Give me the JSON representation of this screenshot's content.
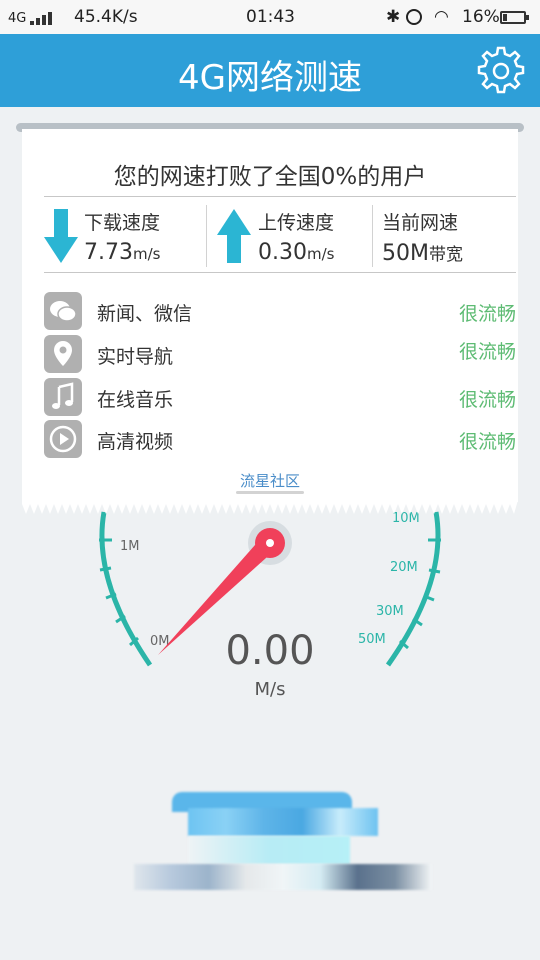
{
  "status_bar": {
    "network": "4G",
    "speed": "45.4K/s",
    "time": "01:43",
    "battery": "16%"
  },
  "header": {
    "title": "4G网络测速"
  },
  "result": {
    "headline": "您的网速打败了全国0%的用户",
    "download": {
      "label": "下载速度",
      "value": "7.73",
      "unit": "m/s"
    },
    "upload": {
      "label": "上传速度",
      "value": "0.30",
      "unit": "m/s"
    },
    "current": {
      "label": "当前网速",
      "value": "50M",
      "unit": "带宽"
    }
  },
  "apps": [
    {
      "name": "新闻、微信",
      "status": "很流畅",
      "icon": "wechat-icon"
    },
    {
      "name": "实时导航",
      "status": "很流畅",
      "icon": "location-pin-icon"
    },
    {
      "name": "在线音乐",
      "status": "很流畅",
      "icon": "music-note-icon"
    },
    {
      "name": "高清视频",
      "status": "很流畅",
      "icon": "play-circle-icon"
    }
  ],
  "community_link": "流星社区",
  "gauge": {
    "ticks_left": [
      "1M",
      "0M"
    ],
    "ticks_right": [
      "10M",
      "20M",
      "30M",
      "50M"
    ],
    "speed": "0.00",
    "unit": "M/s"
  },
  "colors": {
    "header_bg": "#2e9fd8",
    "accent_teal": "#2bb5a8",
    "needle": "#f0405a",
    "status_green": "#5dbb73"
  }
}
